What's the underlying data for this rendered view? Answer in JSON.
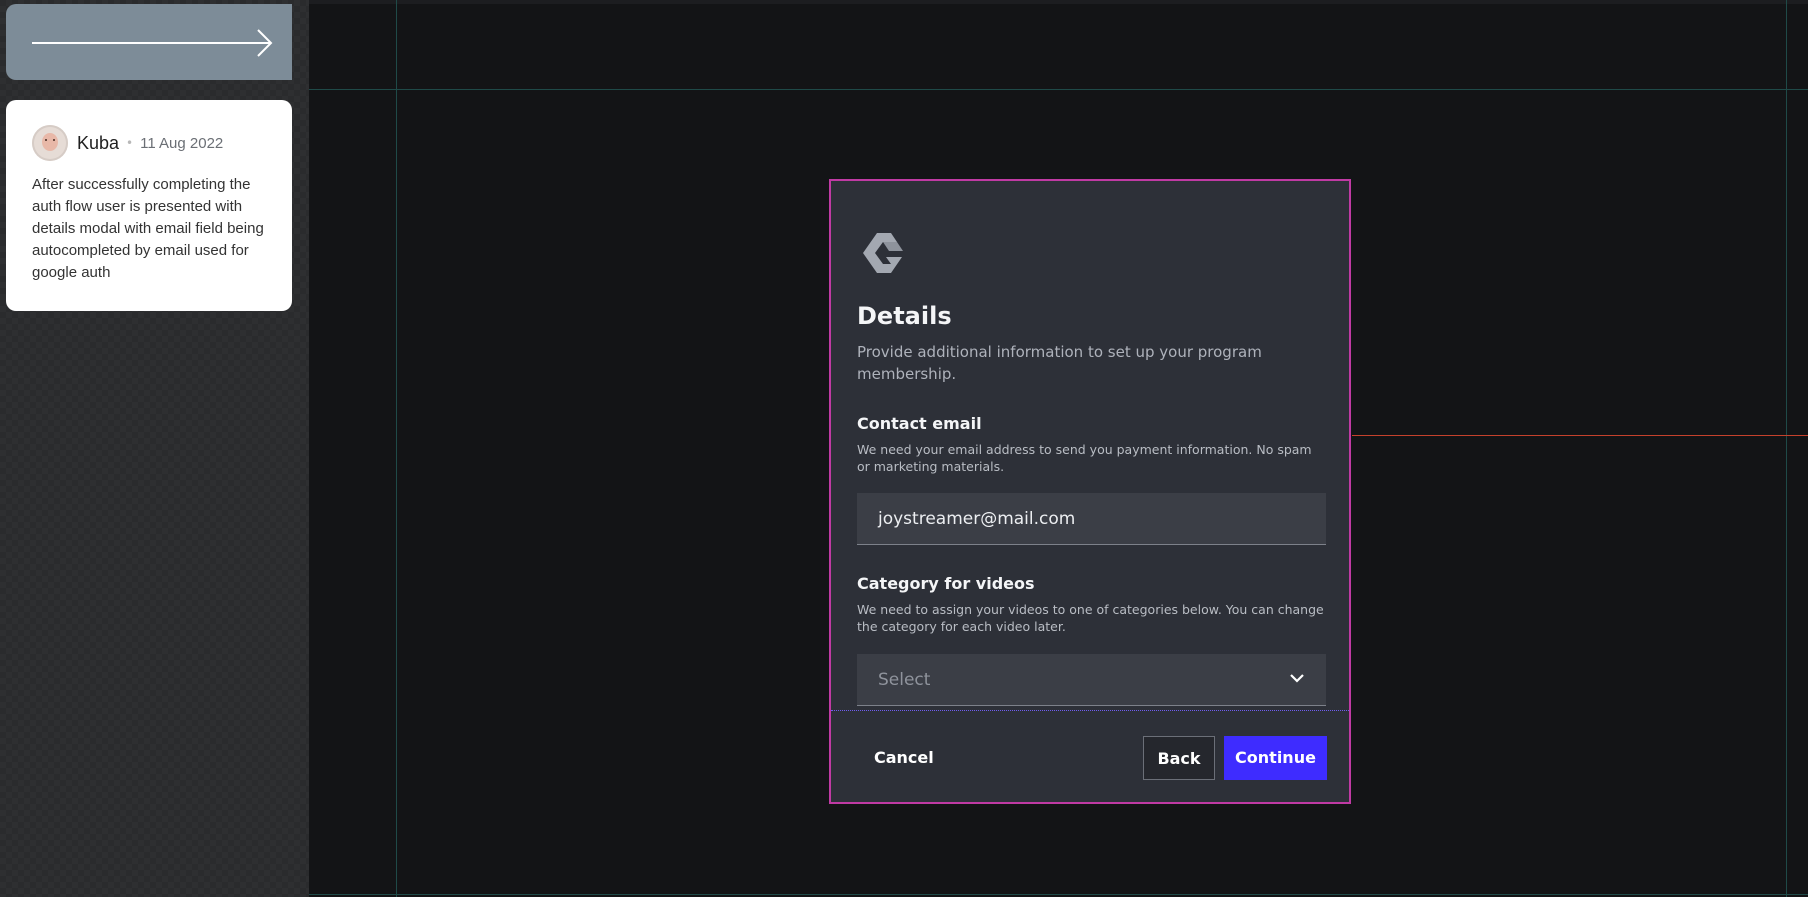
{
  "sidebar": {
    "comment": {
      "author": "Kuba",
      "separator": "•",
      "date": "11 Aug 2022",
      "text": "After successfully completing the auth flow user is presented with details modal with email field being autocompleted by email used for google auth"
    }
  },
  "modal": {
    "title": "Details",
    "description": "Provide additional information to set up your program membership.",
    "email_label": "Contact email",
    "email_help": "We need your email address to send you payment information. No spam or marketing materials.",
    "email_value": "joystreamer@mail.com",
    "category_label": "Category for videos",
    "category_help": "We need to assign your videos to one of categories below. You can change the category for each video later.",
    "category_placeholder": "Select",
    "cancel_label": "Cancel",
    "back_label": "Back",
    "continue_label": "Continue"
  },
  "colors": {
    "accent": "#3e2cff",
    "modal_border": "#c03aa4",
    "modal_bg": "#2d3038"
  }
}
